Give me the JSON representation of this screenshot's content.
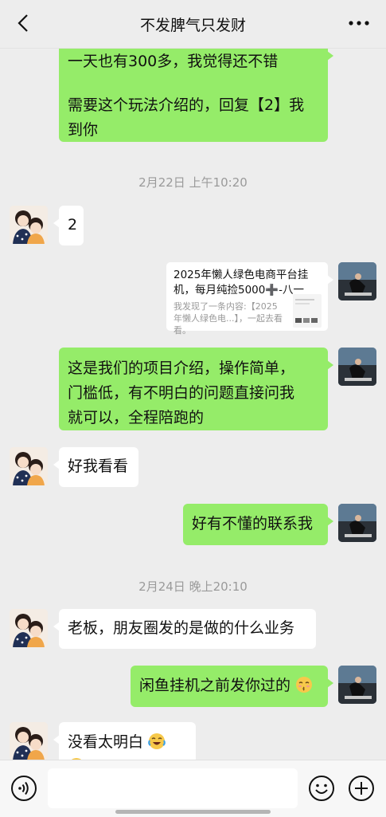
{
  "header": {
    "title": "不发脾气只发财"
  },
  "messages": {
    "m1_line1": "一天也有300多，我觉得还不错",
    "m1_line2": "需要这个玩法介绍的，回复【2】我",
    "m1_line3": "到你",
    "t1": "2月22日 上午10:20",
    "m2": "2",
    "card_title": "2025年懒人绿色电商平台挂机，每月纯捡5000➕-八一",
    "card_desc": "我发现了一条内容:【2025年懒人绿色电...】，一起去看看。",
    "m3_line1": "这是我们的项目介绍，操作简单，",
    "m3_line2": "门槛低，有不明白的问题直接问我",
    "m3_line3": "就可以，全程陪跑的",
    "m4": "好我看看",
    "m5": "好有不懂的联系我",
    "t2": "2月24日 晚上20:10",
    "m6": "老板，朋友圈发的是做的什么业务",
    "m7": "闲鱼挂机之前发你过的",
    "m8": "没看太明白"
  },
  "icons": {
    "back": "chevron-left-icon",
    "more": "more-dots-icon",
    "voice": "voice-icon",
    "emoji": "smile-icon",
    "plus": "plus-icon",
    "kiss_emoji": "kiss-emoji-icon",
    "laugh_cry_emoji": "laugh-cry-emoji-icon"
  },
  "colors": {
    "background": "#ededed",
    "my_bubble": "#95ec69",
    "their_bubble": "#ffffff"
  }
}
